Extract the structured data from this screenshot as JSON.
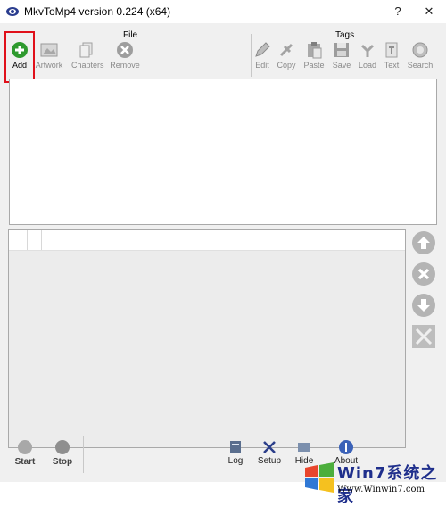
{
  "window": {
    "title": "MkvToMp4 version 0.224 (x64)",
    "help_label": "?",
    "close_label": "✕"
  },
  "toolbar": {
    "file_group_label": "File",
    "tags_group_label": "Tags",
    "file_buttons": [
      {
        "label": "Add",
        "icon": "add-circle-icon"
      },
      {
        "label": "Artwork",
        "icon": "artwork-image-icon"
      },
      {
        "label": "Chapters",
        "icon": "chapters-pages-icon"
      },
      {
        "label": "Remove",
        "icon": "remove-circle-icon"
      }
    ],
    "tag_buttons": [
      {
        "label": "Edit",
        "icon": "pencil-icon"
      },
      {
        "label": "Copy",
        "icon": "copy-icon"
      },
      {
        "label": "Paste",
        "icon": "paste-clipboard-icon"
      },
      {
        "label": "Save",
        "icon": "floppy-disk-icon"
      },
      {
        "label": "Load",
        "icon": "load-arrow-icon"
      },
      {
        "label": "Text",
        "icon": "text-document-icon"
      },
      {
        "label": "Search",
        "icon": "search-globe-icon"
      }
    ]
  },
  "side_buttons": [
    {
      "icon": "arrow-up-icon"
    },
    {
      "icon": "remove-x-icon"
    },
    {
      "icon": "arrow-down-icon"
    },
    {
      "icon": "tools-icon"
    }
  ],
  "bottom": {
    "start_label": "Start",
    "stop_label": "Stop",
    "log_label": "Log",
    "setup_label": "Setup",
    "hide_label": "Hide",
    "about_label": "About"
  },
  "watermark": {
    "text1": "Win7系统之家",
    "text2": "Www.Winwin7.com"
  },
  "colors": {
    "highlight": "#e0101a",
    "add_green": "#2e9a2e",
    "disabled_gray": "#9a9a9a"
  }
}
